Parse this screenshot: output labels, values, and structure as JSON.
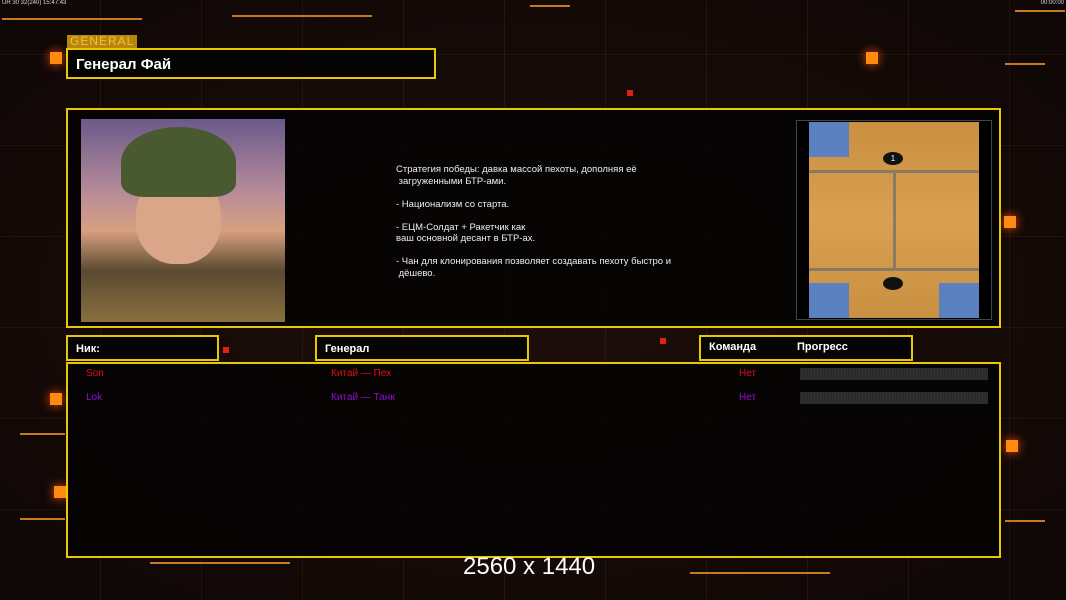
{
  "status_bar": {
    "left": "UR 30 32(240) 15:47:43",
    "right": "00:00:00"
  },
  "general_tag": "GENERAL",
  "general_name": "Генерал Фай",
  "description": "Стратегия победы: давка массой пехоты, дополняя её\n загруженными БТР-ами.\n\n- Национализм со старта.\n\n- ЕЦМ-Солдат + Ракетчик как\nваш основной десант в БТР-ах.\n\n- Чан для клонирования позволяет создавать пехоту быстро и\n дёшево.",
  "map": {
    "markers": [
      "1"
    ]
  },
  "headers": {
    "nick": "Ник:",
    "general": "Генерал",
    "team": "Команда",
    "progress": "Прогресс"
  },
  "players": [
    {
      "nick": "Son",
      "general": "Китай — Пех",
      "team": "Нет",
      "color": "#e01010",
      "progress": 0
    },
    {
      "nick": "Lok",
      "general": "Китай — Танк",
      "team": "Нет",
      "color": "#9010d0",
      "progress": 0
    }
  ],
  "resolution": "2560 x 1440",
  "colors": {
    "frame": "#e8c800",
    "accent": "#ff8a10"
  }
}
